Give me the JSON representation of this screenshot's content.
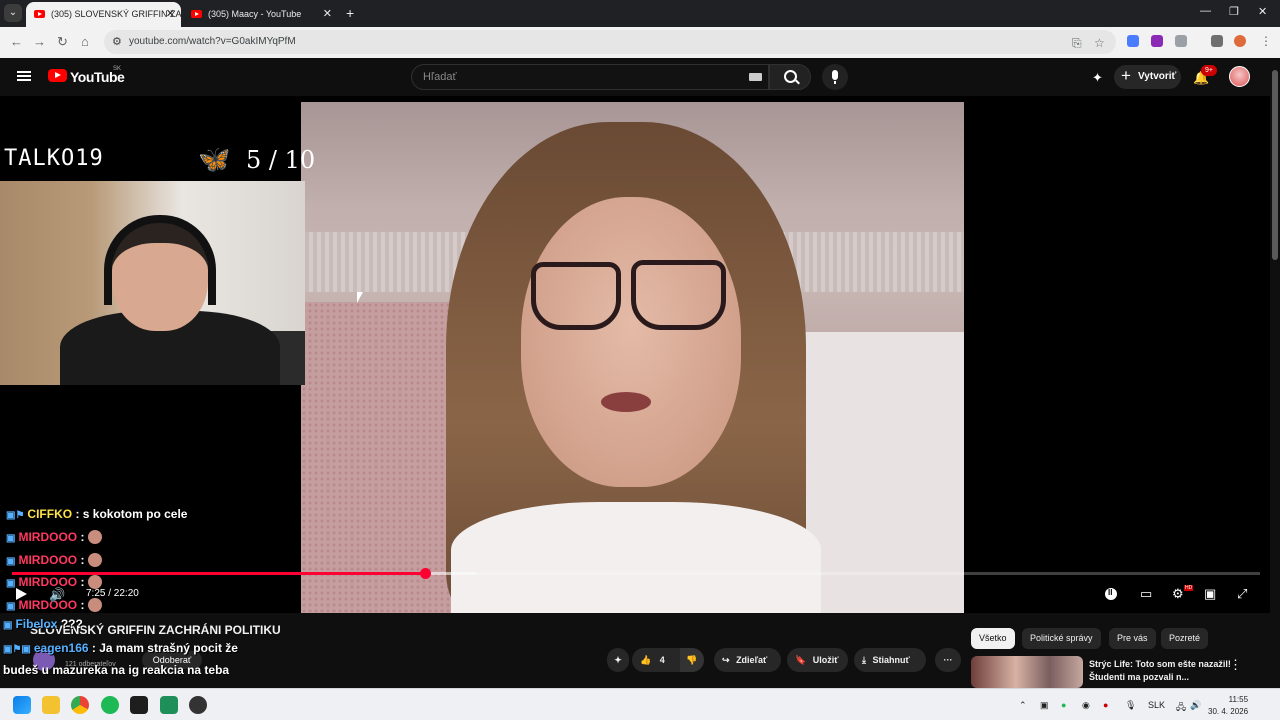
{
  "browser": {
    "tabs": [
      {
        "title": "(305) SLOVENSKÝ GRIFFIN ZAC",
        "close": "✕",
        "active": true
      },
      {
        "title": "(305) Maacy - YouTube",
        "close": "✕",
        "active": false
      }
    ],
    "new_tab": "+",
    "window_controls": {
      "minimize": "—",
      "maximize": "❐",
      "close": "✕"
    },
    "url": "youtube.com/watch?v=G0akIMYqPfM"
  },
  "youtube": {
    "logo_text": "YouTube",
    "country_code": "SK",
    "search_placeholder": "Hľadať",
    "create_label": "Vytvoriť",
    "notification_count": "9+"
  },
  "overlay": {
    "streamer_name": "TALKO19",
    "score": "5 / 10"
  },
  "chat": [
    {
      "user": "CIFFKO",
      "message": ": s kokotom po cele",
      "color": "#ffe14a"
    },
    {
      "user": "MIRDOOO",
      "message": ":",
      "color": "#ff3860"
    },
    {
      "user": "MIRDOOO",
      "message": ":",
      "color": "#ff3860"
    },
    {
      "user": "MIRDOOO",
      "message": ":",
      "color": "#ff3860"
    },
    {
      "user": "MIRDOOO",
      "message": ":",
      "color": "#ff3860"
    },
    {
      "user": "Fibelox",
      "message": "???",
      "color": "#55b0ff"
    },
    {
      "user": "eagen166",
      "message": ": Ja mam strašný pocit že",
      "color": "#55b0ff"
    },
    {
      "user": "",
      "message": "budeš u mazureka na ig reakcia na teba",
      "color": "#ffffff"
    }
  ],
  "player": {
    "time": "7:25 / 22:20",
    "progress_played": 0.331,
    "progress_buffered": 0.372
  },
  "video": {
    "title": "SLOVENSKÝ GRIFFIN ZACHRÁNI POLITIKU",
    "subscribers": "121 odberateľov",
    "unsubscribe_label": "Odoberať",
    "likes": "4",
    "share_label": "Zdieľať",
    "save_label": "Uložiť",
    "download_label": "Stiahnuť",
    "more_label": "···"
  },
  "sidebar": {
    "chips": [
      "Všetko",
      "Politické správy",
      "Pre vás",
      "Pozreté"
    ],
    "recommendation_title": "Strýc Life: Toto som ešte nazažil! Študenti ma pozvali n..."
  },
  "taskbar": {
    "language": "SLK",
    "time": "11:55",
    "date": "30. 4. 2026"
  }
}
